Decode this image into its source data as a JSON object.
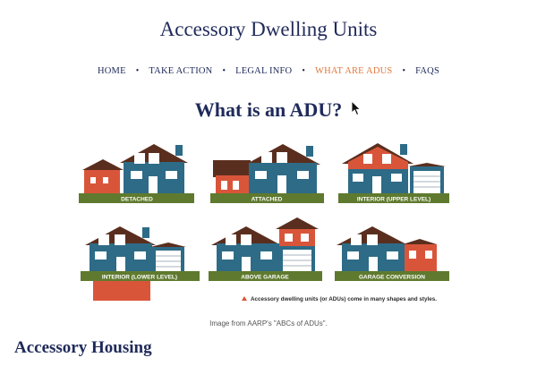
{
  "site": {
    "title": "Accessory Dwelling Units"
  },
  "nav": {
    "items": [
      {
        "label": "HOME",
        "active": false
      },
      {
        "label": "TAKE ACTION",
        "active": false
      },
      {
        "label": "LEGAL INFO",
        "active": false
      },
      {
        "label": "WHAT ARE ADUS",
        "active": true
      },
      {
        "label": "FAQS",
        "active": false
      }
    ],
    "separator": "•"
  },
  "main": {
    "heading": "What is an ADU?",
    "infographic": {
      "labels": [
        "DETACHED",
        "ATTACHED",
        "INTERIOR (UPPER LEVEL)",
        "INTERIOR (LOWER LEVEL)",
        "ABOVE GARAGE",
        "GARAGE CONVERSION"
      ],
      "legend": "Accessory dwelling units (or ADUs) come in many shapes and styles.",
      "colors": {
        "house": "#2e6b87",
        "adu": "#d9553a",
        "roof": "#5a2e1e",
        "ground": "#5f7a2e",
        "window": "#ffffff"
      }
    },
    "caption": "Image from AARP's \"ABCs of ADUs\".",
    "section_heading": "Accessory Housing"
  }
}
